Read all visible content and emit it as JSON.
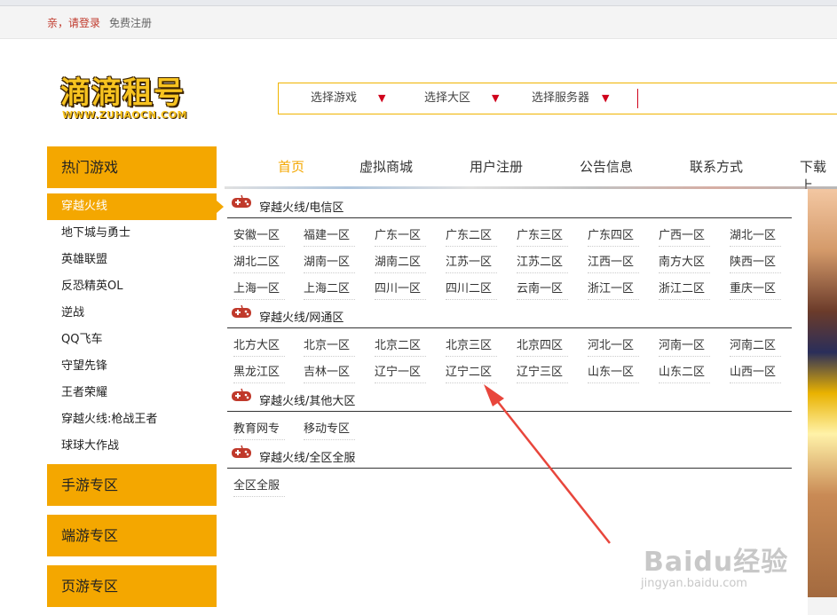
{
  "topbar": {
    "login_text": "亲，请登录",
    "register_text": "免费注册"
  },
  "logo": {
    "title": "滴滴租号",
    "url_text": "WWW.ZUHAOCN.COM"
  },
  "search": {
    "game_select": "选择游戏",
    "region_select": "选择大区",
    "server_select": "选择服务器",
    "arrow_glyph": "▼"
  },
  "sidebar": {
    "hot_games_title": "热门游戏",
    "items": [
      "穿越火线",
      "地下城与勇士",
      "英雄联盟",
      "反恐精英OL",
      "逆战",
      "QQ飞车",
      "守望先锋",
      "王者荣耀",
      "穿越火线:枪战王者",
      "球球大作战"
    ],
    "mobile_title": "手游专区",
    "client_title": "端游专区",
    "web_title": "页游专区"
  },
  "nav": {
    "items": [
      "首页",
      "虚拟商城",
      "用户注册",
      "公告信息",
      "联系方式",
      "下载上"
    ]
  },
  "sections": [
    {
      "title": "穿越火线/电信区",
      "servers": [
        "安徽一区",
        "福建一区",
        "广东一区",
        "广东二区",
        "广东三区",
        "广东四区",
        "广西一区",
        "湖北一区",
        "湖北二区",
        "湖南一区",
        "湖南二区",
        "江苏一区",
        "江苏二区",
        "江西一区",
        "南方大区",
        "陕西一区",
        "上海一区",
        "上海二区",
        "四川一区",
        "四川二区",
        "云南一区",
        "浙江一区",
        "浙江二区",
        "重庆一区"
      ]
    },
    {
      "title": "穿越火线/网通区",
      "servers": [
        "北方大区",
        "北京一区",
        "北京二区",
        "北京三区",
        "北京四区",
        "河北一区",
        "河南一区",
        "河南二区",
        "黑龙江区",
        "吉林一区",
        "辽宁一区",
        "辽宁二区",
        "辽宁三区",
        "山东一区",
        "山东二区",
        "山西一区"
      ]
    },
    {
      "title": "穿越火线/其他大区",
      "servers": [
        "教育网专",
        "移动专区"
      ]
    },
    {
      "title": "穿越火线/全区全服",
      "servers": [
        "全区全服"
      ]
    }
  ],
  "watermark": {
    "brand": "Baidu经验",
    "url": "jingyan.baidu.com"
  },
  "colors": {
    "accent": "#f4a700",
    "red": "#d0021b"
  }
}
